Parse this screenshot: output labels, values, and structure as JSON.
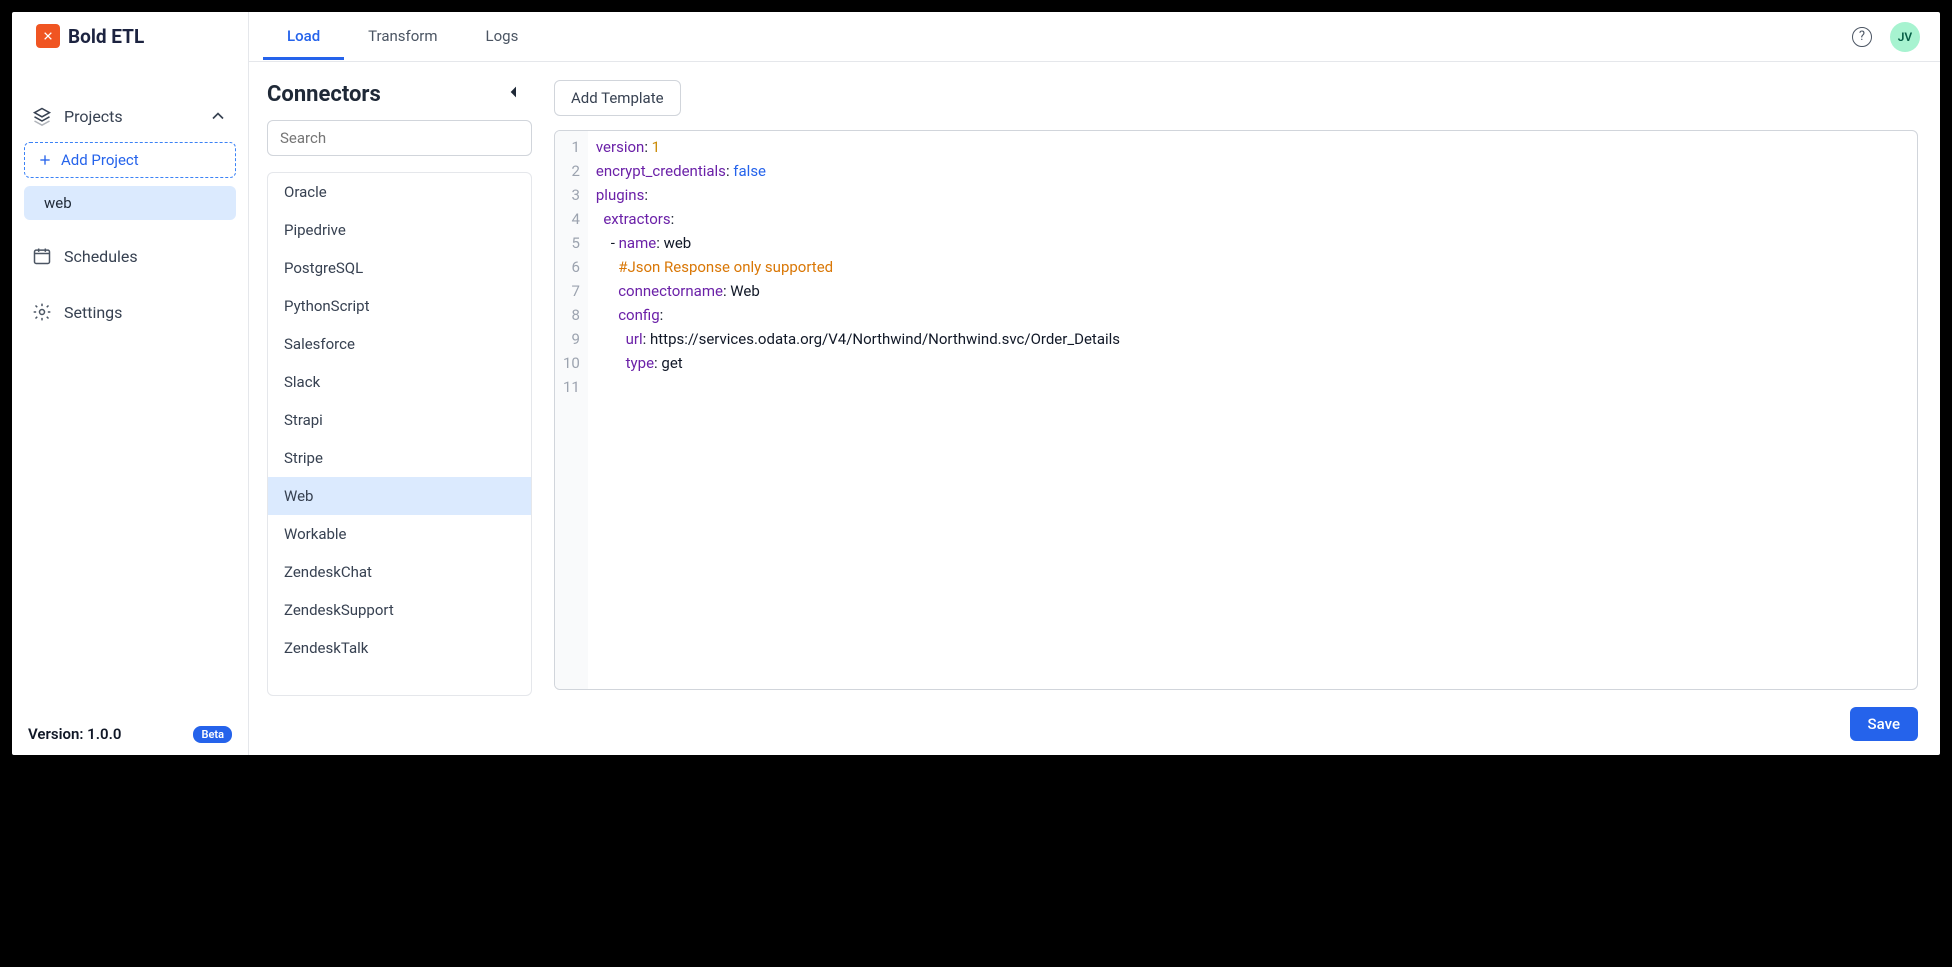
{
  "brand": {
    "name": "Bold ETL"
  },
  "sidebar": {
    "projects_label": "Projects",
    "add_project_label": "Add Project",
    "project_items": [
      "web"
    ],
    "schedules_label": "Schedules",
    "settings_label": "Settings",
    "version_label": "Version: 1.0.0",
    "beta_label": "Beta"
  },
  "topbar": {
    "tabs": [
      "Load",
      "Transform",
      "Logs"
    ],
    "active_tab": "Load",
    "avatar_initials": "JV"
  },
  "connectors": {
    "title": "Connectors",
    "search_placeholder": "Search",
    "items": [
      "Oracle",
      "Pipedrive",
      "PostgreSQL",
      "PythonScript",
      "Salesforce",
      "Slack",
      "Strapi",
      "Stripe",
      "Web",
      "Workable",
      "ZendeskChat",
      "ZendeskSupport",
      "ZendeskTalk"
    ],
    "selected": "Web"
  },
  "editor": {
    "add_template_label": "Add Template",
    "save_label": "Save",
    "code": {
      "version_key": "version",
      "version_val": "1",
      "encrypt_key": "encrypt_credentials",
      "encrypt_val": "false",
      "plugins_key": "plugins",
      "extractors_key": "extractors",
      "name_key": "name",
      "name_val": "web",
      "comment": "#Json Response only supported",
      "connectorname_key": "connectorname",
      "connectorname_val": "Web",
      "config_key": "config",
      "url_key": "url",
      "url_val": "https://services.odata.org/V4/Northwind/Northwind.svc/Order_Details",
      "type_key": "type",
      "type_val": "get"
    }
  }
}
